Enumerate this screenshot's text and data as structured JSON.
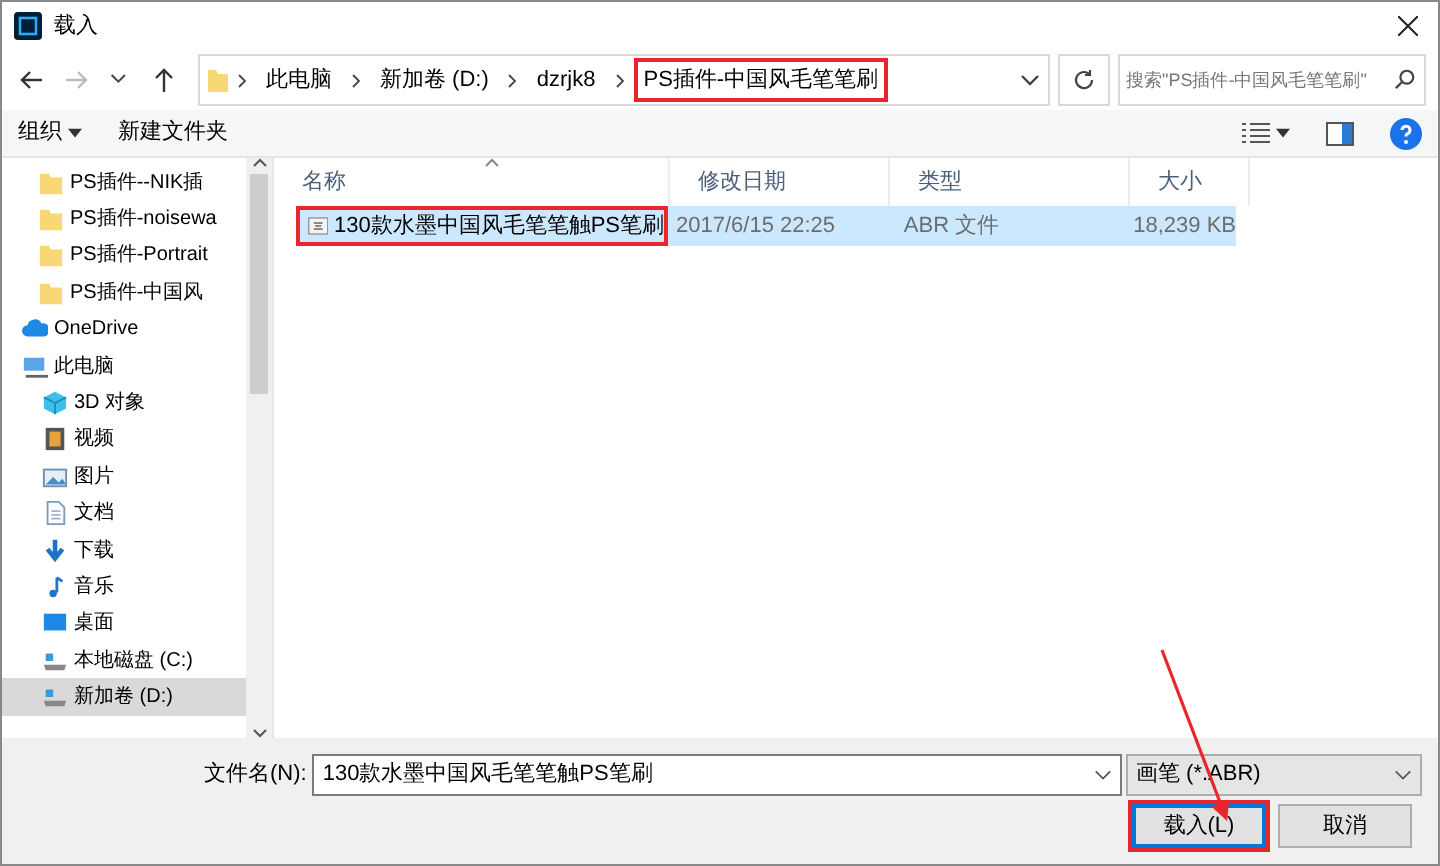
{
  "window": {
    "title": "载入"
  },
  "address_bar": {
    "segments": [
      {
        "label": "此电脑",
        "annotated": false
      },
      {
        "label": "新加卷 (D:)",
        "annotated": false
      },
      {
        "label": "dzrjk8",
        "annotated": false
      },
      {
        "label": "PS插件-中国风毛笔笔刷",
        "annotated": true
      }
    ]
  },
  "search": {
    "placeholder": "搜索\"PS插件-中国风毛笔笔刷\""
  },
  "toolbar": {
    "organize": "组织",
    "new_folder": "新建文件夹"
  },
  "sidebar": {
    "items": [
      {
        "kind": "folder",
        "label": "PS插件--NIK插",
        "selected": false
      },
      {
        "kind": "folder",
        "label": "PS插件-noisewa",
        "selected": false
      },
      {
        "kind": "folder",
        "label": "PS插件-Portrait",
        "selected": false
      },
      {
        "kind": "folder",
        "label": "PS插件-中国风",
        "selected": false
      },
      {
        "kind": "cloud",
        "label": "OneDrive",
        "selected": false
      },
      {
        "kind": "computer",
        "label": "此电脑",
        "selected": false,
        "children": [
          {
            "kind": "cube",
            "label": "3D 对象",
            "selected": false
          },
          {
            "kind": "video",
            "label": "视频",
            "selected": false
          },
          {
            "kind": "picture",
            "label": "图片",
            "selected": false
          },
          {
            "kind": "document",
            "label": "文档",
            "selected": false
          },
          {
            "kind": "download",
            "label": "下载",
            "selected": false
          },
          {
            "kind": "music",
            "label": "音乐",
            "selected": false
          },
          {
            "kind": "desktop",
            "label": "桌面",
            "selected": false
          },
          {
            "kind": "drive",
            "label": "本地磁盘 (C:)",
            "selected": false
          },
          {
            "kind": "drive",
            "label": "新加卷 (D:)",
            "selected": true
          }
        ]
      }
    ]
  },
  "table": {
    "columns": [
      "名称",
      "修改日期",
      "类型",
      "大小"
    ],
    "rows": [
      {
        "cells": [
          "130款水墨中国风毛笔笔触PS笔刷",
          "2017/6/15 22:25",
          "ABR 文件",
          "18,239 KB"
        ],
        "selected": true,
        "annotated": true
      }
    ]
  },
  "footer": {
    "filename_label": "文件名(N):",
    "filename": "130款水墨中国风毛笔笔触PS笔刷",
    "file_type": "画笔 (*.ABR)",
    "buttons": [
      {
        "label": "载入(L)",
        "kind": "primary",
        "annotated": true
      },
      {
        "label": "取消",
        "kind": "secondary",
        "annotated": false
      }
    ]
  }
}
